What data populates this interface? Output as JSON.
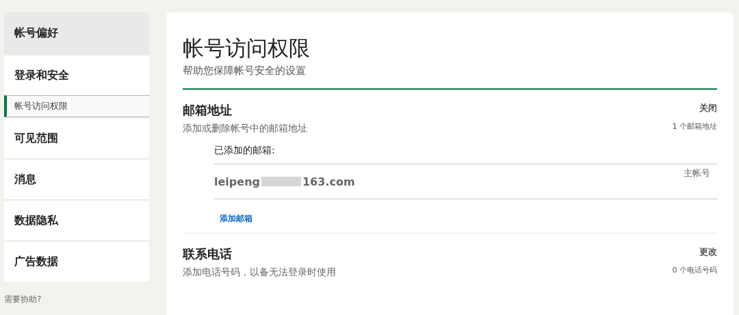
{
  "sidebar": {
    "items": [
      {
        "kind": "header",
        "label": "帐号偏好",
        "selected": false
      },
      {
        "kind": "item",
        "label": "登录和安全",
        "selected": false
      },
      {
        "kind": "subitem",
        "label": "帐号访问权限",
        "selected": true
      },
      {
        "kind": "item",
        "label": "可见范围",
        "selected": false
      },
      {
        "kind": "item",
        "label": "消息",
        "selected": false
      },
      {
        "kind": "item",
        "label": "数据隐私",
        "selected": false
      },
      {
        "kind": "item",
        "label": "广告数据",
        "selected": false
      }
    ],
    "help_text": "需要协助?"
  },
  "main": {
    "title": "帐号访问权限",
    "subtitle": "帮助您保障帐号安全的设置",
    "sections": [
      {
        "title": "邮箱地址",
        "description": "添加或删除帐号中的邮箱地址",
        "action": "关闭",
        "summary": "1 个邮箱地址",
        "detail": {
          "heading": "已添加的邮箱:",
          "email_start": "leipeng",
          "email_end": "163.com",
          "tag": "主帐号",
          "link": "添加邮箱"
        }
      },
      {
        "title": "联系电话",
        "description": "添加电话号码，以备无法登录时使用",
        "action": "更改",
        "summary": "0 个电话号码"
      }
    ]
  }
}
